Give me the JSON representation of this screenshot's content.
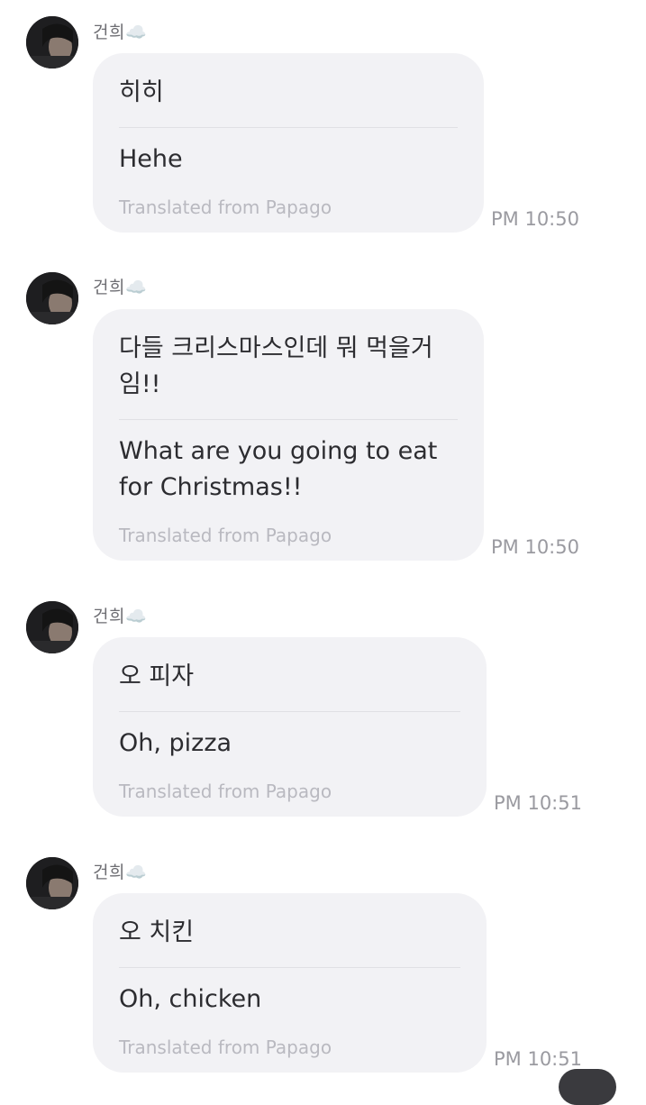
{
  "messages": [
    {
      "sender": "건희☁️",
      "original": "히히",
      "translated": "Hehe",
      "source": "Translated from Papago",
      "time": "PM 10:50"
    },
    {
      "sender": "건희☁️",
      "original": "다들 크리스마스인데 뭐 먹을거 임!!",
      "translated": "What are you going to eat for Christmas!!",
      "source": "Translated from Papago",
      "time": "PM 10:50"
    },
    {
      "sender": "건희☁️",
      "original": "오 피자",
      "translated": "Oh, pizza",
      "source": "Translated from Papago",
      "time": "PM 10:51"
    },
    {
      "sender": "건희☁️",
      "original": "오 치킨",
      "translated": "Oh, chicken",
      "source": "Translated from Papago",
      "time": "PM 10:51"
    }
  ]
}
